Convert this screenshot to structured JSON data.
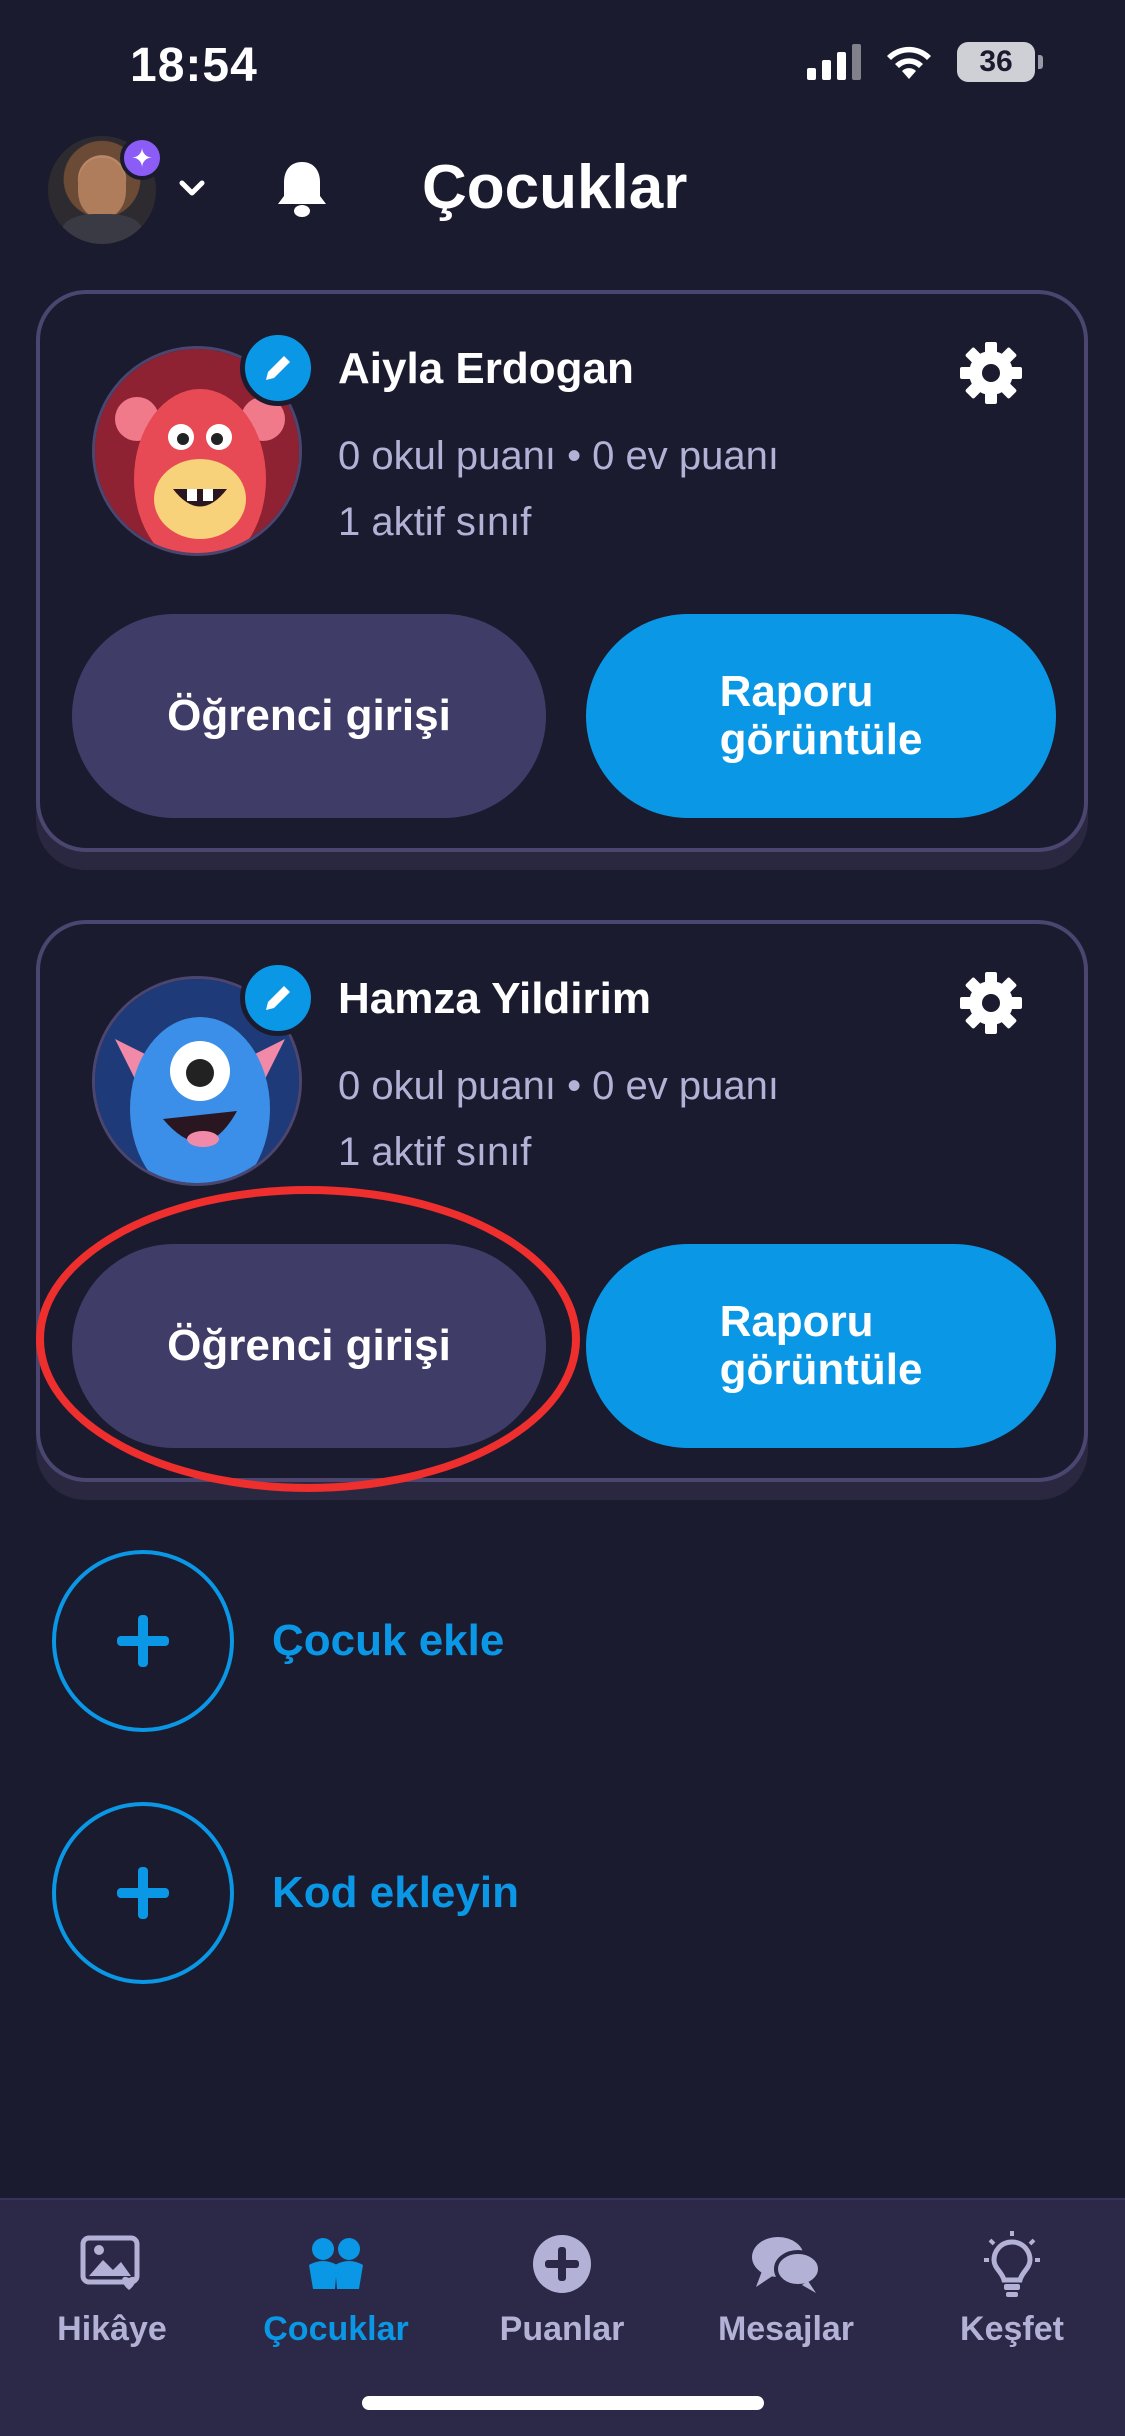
{
  "status_bar": {
    "time": "18:54",
    "battery": "36"
  },
  "header": {
    "title": "Çocuklar"
  },
  "children": [
    {
      "name": "Aiyla Erdogan",
      "points": "0 okul puanı • 0 ev puanı",
      "classes": "1 aktif sınıf",
      "student_login_label": "Öğrenci girişi",
      "report_label_line1": "Raporu",
      "report_label_line2": "görüntüle",
      "avatar_icon": "red-monster-avatar"
    },
    {
      "name": "Hamza Yildirim",
      "points": "0 okul puanı • 0 ev puanı",
      "classes": "1 aktif sınıf",
      "student_login_label": "Öğrenci girişi",
      "report_label_line1": "Raporu",
      "report_label_line2": "görüntüle",
      "avatar_icon": "blue-monster-avatar"
    }
  ],
  "actions": {
    "add_child_label": "Çocuk ekle",
    "add_code_label": "Kod ekleyin"
  },
  "nav": [
    {
      "label": "Hikâye",
      "icon": "story-icon"
    },
    {
      "label": "Çocuklar",
      "icon": "children-icon",
      "active": true
    },
    {
      "label": "Puanlar",
      "icon": "points-icon"
    },
    {
      "label": "Mesajlar",
      "icon": "messages-icon"
    },
    {
      "label": "Keşfet",
      "icon": "discover-icon"
    }
  ],
  "colors": {
    "background": "#1b1b2f",
    "accent": "#0a97e6",
    "button_secondary": "#403c68",
    "highlight": "#ef2e2e"
  }
}
